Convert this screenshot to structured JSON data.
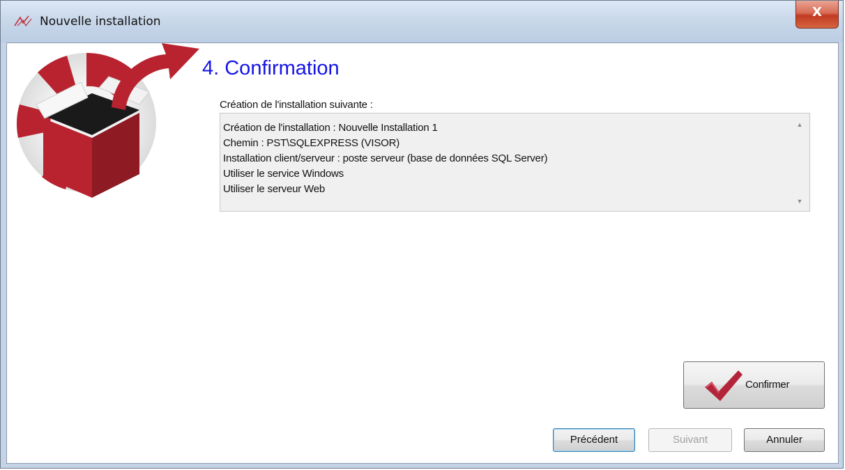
{
  "window": {
    "title": "Nouvelle installation",
    "close_symbol": "X"
  },
  "step": {
    "title": "4. Confirmation",
    "section_label": "Création de l'installation suivante :"
  },
  "summary": {
    "lines": [
      "Création de l'installation : Nouvelle Installation 1",
      "Chemin : PST\\SQLEXPRESS (VISOR)",
      "Installation client/serveur : poste serveur (base de données SQL Server)",
      "Utiliser le service Windows",
      "Utiliser le serveur Web"
    ]
  },
  "buttons": {
    "confirm": "Confirmer",
    "previous": "Précédent",
    "next": "Suivant",
    "cancel": "Annuler"
  },
  "icons": {
    "title_icon": "app-logo-icon",
    "logo": "installation-box-icon",
    "confirm": "checkmark-icon"
  },
  "colors": {
    "step_title": "#1414e6",
    "brand_red": "#b8232f",
    "close_button": "#c23a22"
  }
}
